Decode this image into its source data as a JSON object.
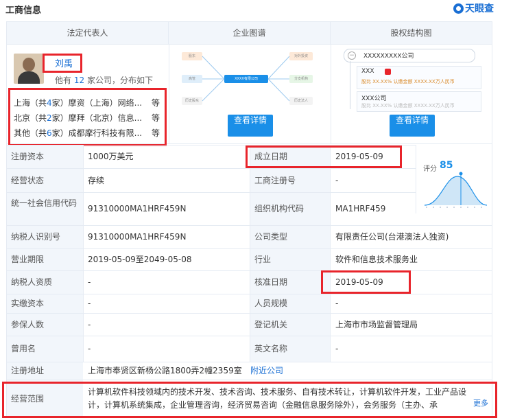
{
  "header": {
    "title": "工商信息",
    "brand": "天眼查"
  },
  "tabs": [
    "法定代表人",
    "企业图谱",
    "股权结构图"
  ],
  "legal_rep": {
    "name": "刘禹",
    "companies_prefix": "他有",
    "companies_count": "12",
    "companies_suffix": "家公司，分布如下",
    "regions": [
      {
        "region": "上海（共",
        "count": "4",
        "tail": "家）摩资（上海）网络...",
        "more": "等"
      },
      {
        "region": "北京（共",
        "count": "2",
        "tail": "家）摩拜（北京）信息...",
        "more": "等"
      },
      {
        "region": "其他（共",
        "count": "6",
        "tail": "家）成都摩行科技有限...",
        "more": "等"
      }
    ]
  },
  "graph": {
    "center": "XXXX有限公司",
    "left": [
      "股东",
      "高管",
      "历史股东"
    ],
    "right": [
      "对外投资",
      "分支机构",
      "历史法人"
    ],
    "button": "查看详情"
  },
  "equity": {
    "company": "XXXXXXXXX公司",
    "holder1": "XXX",
    "holder1_detail": "股比 XX.XX%  认缴金额 XXXX.XX万人民币",
    "holder2": "XXX公司",
    "holder2_detail": "股比 XX.XX%  认缴金额 XXXX.XX万人民币",
    "button": "查看详情"
  },
  "score": {
    "label": "评分",
    "value": "85"
  },
  "rows": [
    {
      "l1": "注册资本",
      "v1": "1000万美元",
      "l2": "成立日期",
      "v2": "2019-05-09"
    },
    {
      "l1": "经营状态",
      "v1": "存续",
      "l2": "工商注册号",
      "v2": "-"
    },
    {
      "l1": "统一社会信用代码",
      "v1": "91310000MA1HRF459N",
      "l2": "组织机构代码",
      "v2": "MA1HRF459"
    },
    {
      "l1": "纳税人识别号",
      "v1": "91310000MA1HRF459N",
      "l2": "公司类型",
      "v2": "有限责任公司(台港澳法人独资)"
    },
    {
      "l1": "营业期限",
      "v1": "2019-05-09至2049-05-08",
      "l2": "行业",
      "v2": "软件和信息技术服务业"
    },
    {
      "l1": "纳税人资质",
      "v1": "-",
      "l2": "核准日期",
      "v2": "2019-05-09"
    },
    {
      "l1": "实缴资本",
      "v1": "-",
      "l2": "人员规模",
      "v2": "-"
    },
    {
      "l1": "参保人数",
      "v1": "-",
      "l2": "登记机关",
      "v2": "上海市市场监督管理局"
    },
    {
      "l1": "曾用名",
      "v1": "-",
      "l2": "英文名称",
      "v2": "-"
    }
  ],
  "address": {
    "label": "注册地址",
    "value": "上海市奉贤区新杨公路1800弄2幢2359室",
    "link": "附近公司"
  },
  "scope": {
    "label": "经营范围",
    "line1": "计算机软件科技领域内的技术开发、技术咨询、技术服务、自有技术转让，计算机软件开发，工业产品设",
    "line2": "计，计算机系统集成，企业管理咨询，经济贸易咨询（金融信息服务除外），会务服务（主办、承",
    "more": "更多"
  }
}
